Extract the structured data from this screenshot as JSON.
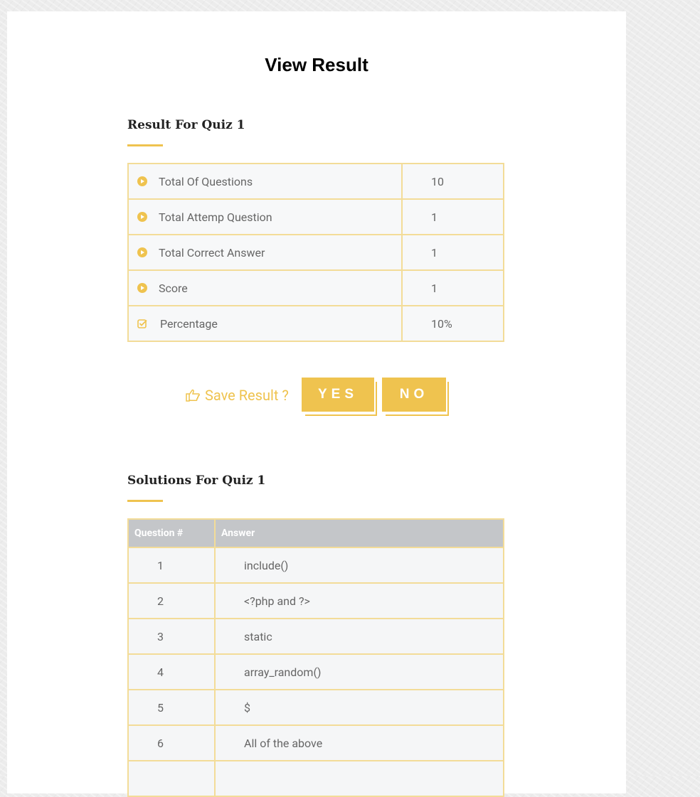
{
  "page": {
    "title": "View Result"
  },
  "result": {
    "heading": "Result For Quiz 1",
    "rows": [
      {
        "label": "Total Of Questions",
        "value": "10",
        "icon": "play-circle-icon"
      },
      {
        "label": "Total Attemp Question",
        "value": "1",
        "icon": "play-circle-icon"
      },
      {
        "label": "Total Correct Answer",
        "value": "1",
        "icon": "play-circle-icon"
      },
      {
        "label": "Score",
        "value": "1",
        "icon": "play-circle-icon"
      },
      {
        "label": "Percentage",
        "value": "10%",
        "icon": "checkbox-icon"
      }
    ]
  },
  "save": {
    "label": "Save Result ?",
    "icon": "hand-pointer-icon",
    "yes": "YES",
    "no": "NO"
  },
  "solutions": {
    "heading": "Solutions For Quiz 1",
    "columns": [
      "Question #",
      "Answer"
    ],
    "rows": [
      {
        "num": "1",
        "answer": "include()"
      },
      {
        "num": "2",
        "answer": "<?php and ?>"
      },
      {
        "num": "3",
        "answer": "static"
      },
      {
        "num": "4",
        "answer": "array_random()"
      },
      {
        "num": "5",
        "answer": "$"
      },
      {
        "num": "6",
        "answer": "All of the above"
      },
      {
        "num": "",
        "answer": ""
      }
    ]
  },
  "colors": {
    "accent": "#efc34f",
    "border": "#f3dc98",
    "header_bg": "#c4c6c9"
  }
}
